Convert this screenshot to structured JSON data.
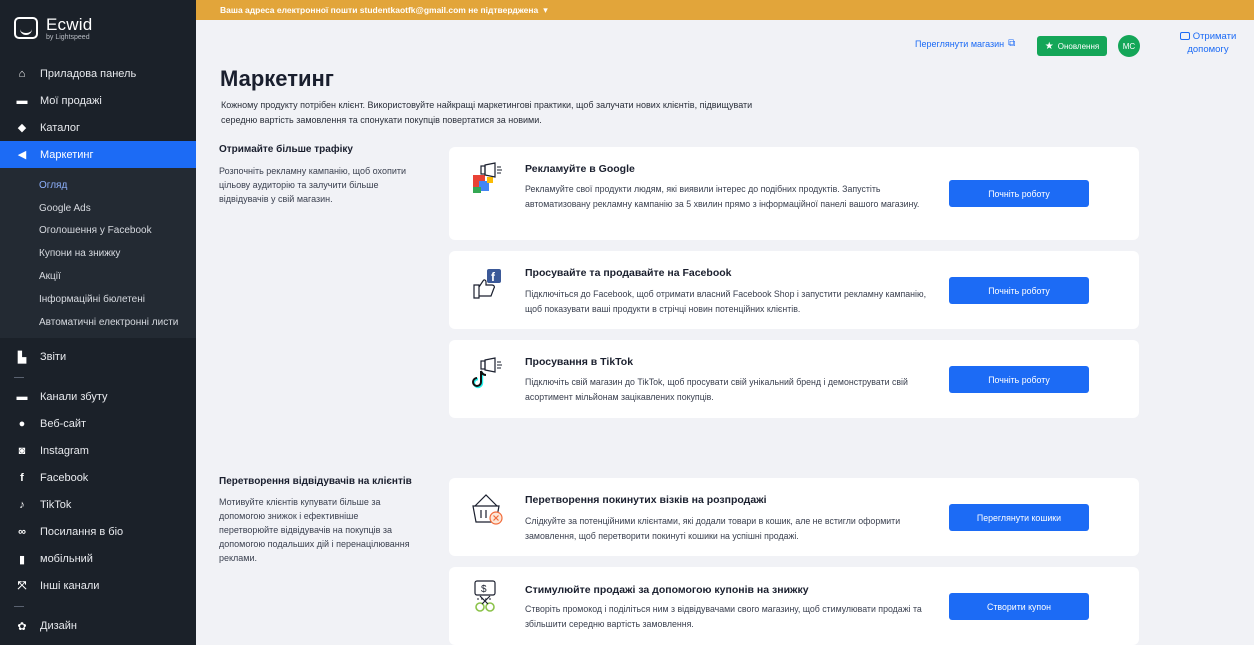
{
  "brand": {
    "name": "Ecwid",
    "sub": "by Lightspeed"
  },
  "notice": {
    "text": "Ваша адреса електронної пошти studentkaotfk@gmail.com не підтверджена",
    "chevron": "▾"
  },
  "header": {
    "view_store": "Переглянути магазин",
    "updates": "Оновлення",
    "avatar": "MC",
    "help": "Отримати допомогу"
  },
  "sidebar": {
    "items_top": [
      {
        "label": "Приладова панель",
        "icon": "home-icon"
      },
      {
        "label": "Мої продажі",
        "icon": "sales-icon"
      },
      {
        "label": "Каталог",
        "icon": "tag-icon"
      },
      {
        "label": "Маркетинг",
        "icon": "megaphone-icon",
        "active": true
      }
    ],
    "sub_items": [
      {
        "label": "Огляд",
        "active": true
      },
      {
        "label": "Google Ads"
      },
      {
        "label": "Оголошення у Facebook"
      },
      {
        "label": "Купони на знижку"
      },
      {
        "label": "Акції"
      },
      {
        "label": "Інформаційні бюлетені"
      },
      {
        "label": "Автоматичні електронні листи"
      }
    ],
    "reports": "Звіти",
    "channels": [
      {
        "label": "Канали збуту",
        "icon": "channels-icon"
      },
      {
        "label": "Веб-сайт",
        "icon": "globe-icon"
      },
      {
        "label": "Instagram",
        "icon": "instagram-icon"
      },
      {
        "label": "Facebook",
        "icon": "facebook-icon"
      },
      {
        "label": "TikTok",
        "icon": "tiktok-icon"
      },
      {
        "label": "Посилання в біо",
        "icon": "link-icon"
      },
      {
        "label": "мобільний",
        "icon": "mobile-icon"
      },
      {
        "label": "Інші канали",
        "icon": "other-channels-icon"
      }
    ],
    "design": "Дизайн"
  },
  "page": {
    "title": "Маркетинг",
    "intro": "Кожному продукту потрібен клієнт. Використовуйте найкращі маркетингові практики, щоб залучати нових клієнтів, підвищувати середню вартість замовлення та спонукати покупців повертатися за новими."
  },
  "sections": [
    {
      "title": "Отримайте більше трафіку",
      "desc": "Розпочніть рекламну кампанію, щоб охопити цільову аудиторію та залучити більше відвідувачів у свій магазин.",
      "cards": [
        {
          "title": "Рекламуйте в Google",
          "desc": "Рекламуйте свої продукти людям, які виявили інтерес до подібних продуктів. Запустіть автоматизовану рекламну кампанію за 5 хвилин прямо з інформаційної панелі вашого магазину.",
          "button": "Почніть роботу",
          "icon": "google-ads-icon"
        },
        {
          "title": "Просувайте та продавайте на Facebook",
          "desc": "Підключіться до Facebook, щоб отримати власний Facebook Shop і запустити рекламну кампанію, щоб показувати ваші продукти в стрічці новин потенційних клієнтів.",
          "button": "Почніть роботу",
          "icon": "facebook-like-icon"
        },
        {
          "title": "Просування в TikTok",
          "desc": "Підключіть свій магазин до TikTok, щоб просувати свій унікальний бренд і демонструвати свій асортимент мільйонам зацікавлених покупців.",
          "button": "Почніть роботу",
          "icon": "tiktok-megaphone-icon"
        }
      ]
    },
    {
      "title": "Перетворення відвідувачів на клієнтів",
      "desc": "Мотивуйте клієнтів купувати більше за допомогою знижок і ефективніше перетворюйте відвідувачів на покупців за допомогою подальших дій і перенацілювання реклами.",
      "cards": [
        {
          "title": "Перетворення покинутих візків на розпродажі",
          "desc": "Слідкуйте за потенційними клієнтами, які додали товари в кошик, але не встигли оформити замовлення, щоб перетворити покинуті кошики на успішні продажі.",
          "button": "Переглянути кошики",
          "icon": "abandoned-cart-icon"
        },
        {
          "title": "Стимулюйте продажі за допомогою купонів на знижку",
          "desc": "Створіть промокод і поділіться ним з відвідувачами свого магазину, щоб стимулювати продажі та збільшити середню вартість замовлення.",
          "button": "Створити купон",
          "icon": "coupon-icon"
        }
      ]
    }
  ],
  "colors": {
    "accent": "#1c6bf5",
    "sidebar": "#1b2129",
    "notice": "#e2a53a",
    "success": "#14a658",
    "orange": "#f26b3a"
  }
}
